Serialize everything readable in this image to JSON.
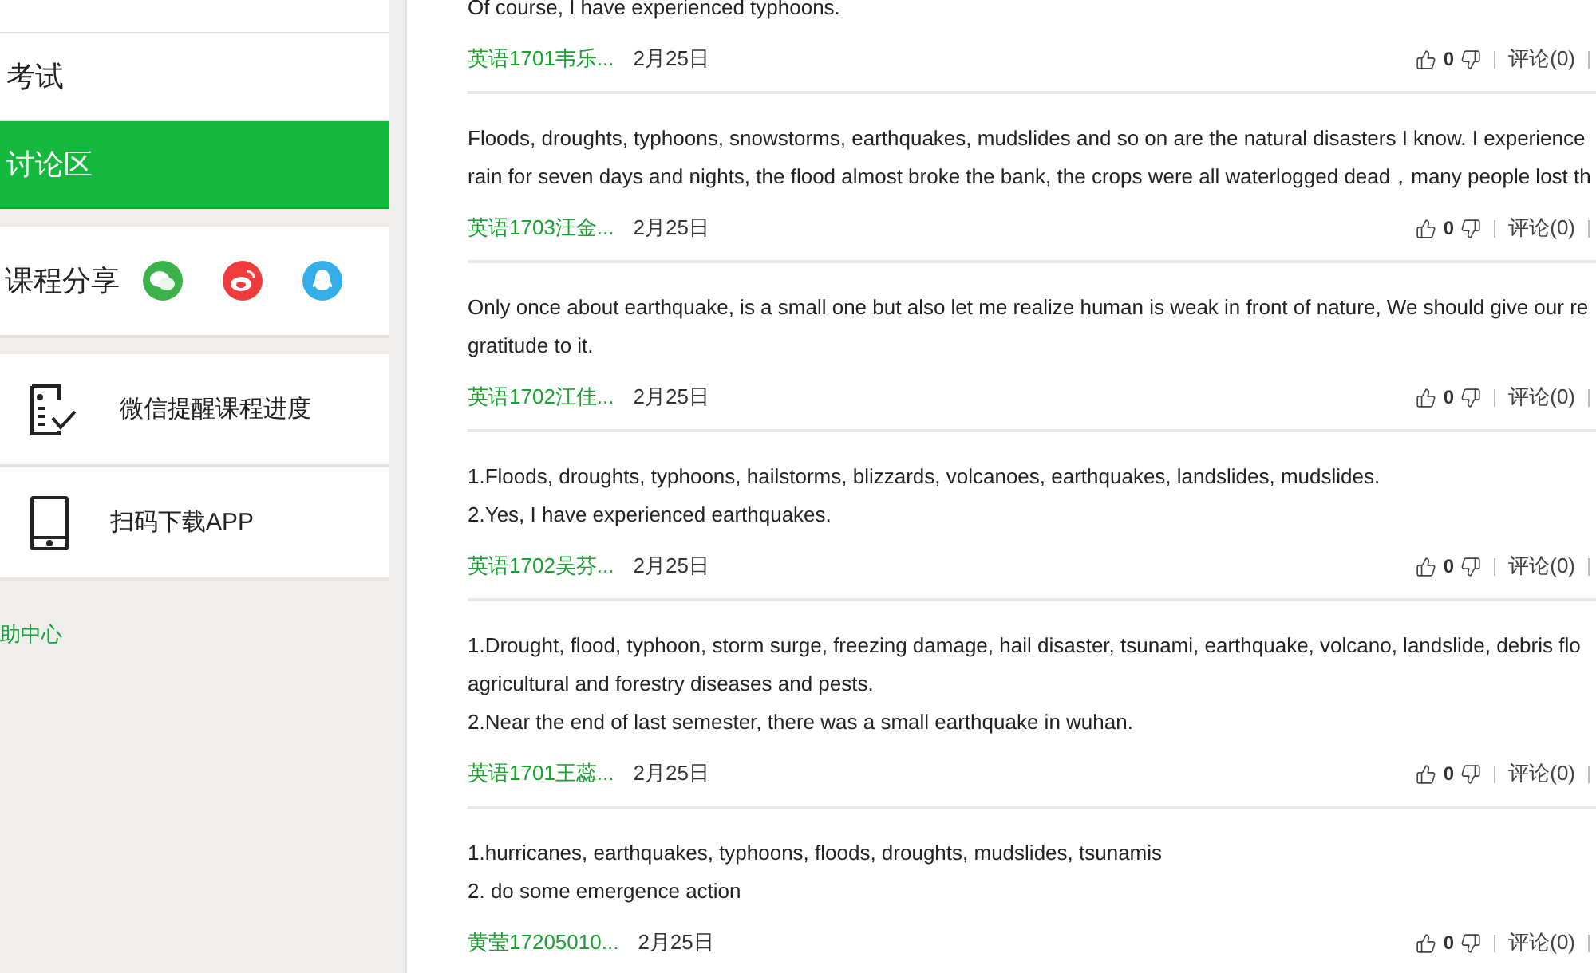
{
  "sidebar": {
    "nav": [
      {
        "label": "考试",
        "selected": false
      },
      {
        "label": "讨论区",
        "selected": true
      }
    ],
    "share": {
      "label": "课程分享"
    },
    "tools": [
      {
        "label": "微信提醒课程进度",
        "kind": "checklist"
      },
      {
        "label": "扫码下载APP",
        "kind": "phone"
      }
    ],
    "help_link": "助中心"
  },
  "posts": [
    {
      "lines": [
        "Of course, I have experienced typhoons."
      ],
      "author": "英语1701韦乐...",
      "date": "2月25日",
      "likes": "0",
      "comments": "评论(0)"
    },
    {
      "lines": [
        "Floods, droughts, typhoons, snowstorms, earthquakes, mudslides and so on are the natural disasters I know. I experience",
        "rain for seven days and nights, the flood almost broke the bank, the crops were all waterlogged dead，many people lost th"
      ],
      "author": "英语1703汪金...",
      "date": "2月25日",
      "likes": "0",
      "comments": "评论(0)"
    },
    {
      "lines": [
        "Only once about earthquake, is a small one but also let me realize human is weak in front of nature, We should give our re",
        "gratitude to it."
      ],
      "author": "英语1702江佳...",
      "date": "2月25日",
      "likes": "0",
      "comments": "评论(0)"
    },
    {
      "lines": [
        "1.Floods, droughts, typhoons, hailstorms, blizzards, volcanoes, earthquakes, landslides, mudslides.",
        "2.Yes, I have experienced earthquakes."
      ],
      "author": "英语1702吴芬...",
      "date": "2月25日",
      "likes": "0",
      "comments": "评论(0)"
    },
    {
      "lines": [
        "1.Drought, flood, typhoon, storm surge, freezing damage, hail disaster, tsunami, earthquake, volcano, landslide, debris flo",
        "agricultural and forestry diseases and pests.",
        "2.Near the end of last semester, there was a small earthquake in wuhan."
      ],
      "author": "英语1701王蕊...",
      "date": "2月25日",
      "likes": "0",
      "comments": "评论(0)"
    },
    {
      "lines": [
        "1.hurricanes, earthquakes, typhoons, floods, droughts, mudslides, tsunamis",
        "2. do some emergence action"
      ],
      "author": "黄莹17205010...",
      "date": "2月25日",
      "likes": "0",
      "comments": "评论(0)"
    }
  ]
}
